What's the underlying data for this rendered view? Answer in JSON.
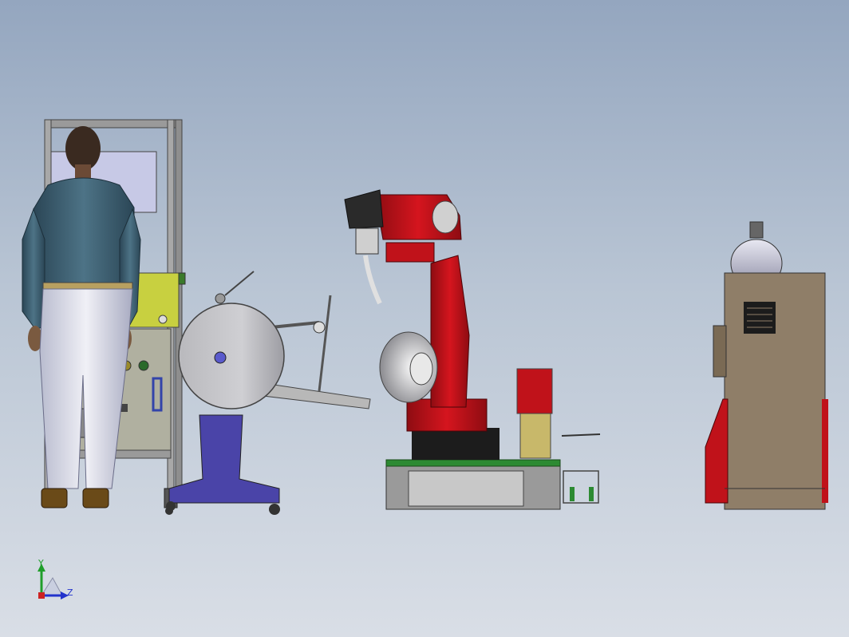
{
  "viewport": {
    "background_top": "#94a6bf",
    "background_bottom": "#d9dee6"
  },
  "triad": {
    "y_label": "Y",
    "z_label": "Z",
    "y_color": "#1f9e2a",
    "z_color": "#2233cc",
    "x_color": "#cc2222"
  },
  "scene": {
    "objects": [
      "operator-figure",
      "control-cabinet",
      "wire-spool-feeder",
      "welding-robot",
      "robot-base-platform",
      "welding-power-source"
    ],
    "colors": {
      "robot_red": "#c0121a",
      "feeder_stand_blue": "#4a44a8",
      "cabinet_yellow": "#c8d040",
      "power_source_tan": "#8f7e68"
    }
  }
}
